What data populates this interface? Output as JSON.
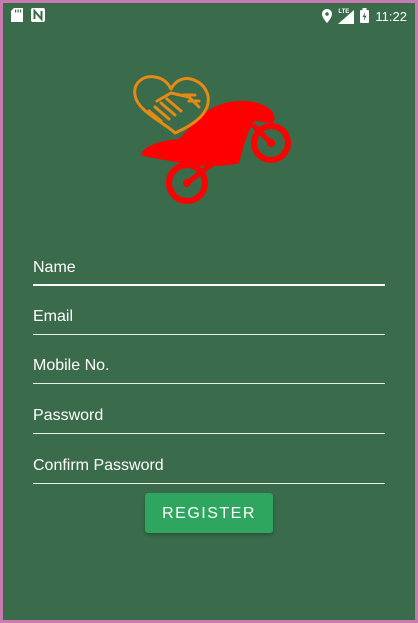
{
  "status_bar": {
    "left_icons": [
      "sd-card-icon",
      "n-notification-icon"
    ],
    "right_icons": [
      "location-icon",
      "lte-signal-icon",
      "battery-icon"
    ],
    "network_label": "LTE",
    "time": "11:22"
  },
  "logo": {
    "icon": "handshake-heart-motorcycle-logo",
    "colors": {
      "heart": "#e58a13",
      "bike": "#ff0000"
    }
  },
  "form": {
    "fields": [
      {
        "placeholder": "Name",
        "value": ""
      },
      {
        "placeholder": "Email",
        "value": ""
      },
      {
        "placeholder": "Mobile No.",
        "value": ""
      },
      {
        "placeholder": "Password",
        "value": ""
      },
      {
        "placeholder": "Confirm Password",
        "value": ""
      }
    ],
    "register_label": "REGISTER"
  },
  "colors": {
    "background": "#3a6b4b",
    "button": "#2ea660",
    "text": "#ffffff",
    "frame_border": "#c77bb0"
  }
}
